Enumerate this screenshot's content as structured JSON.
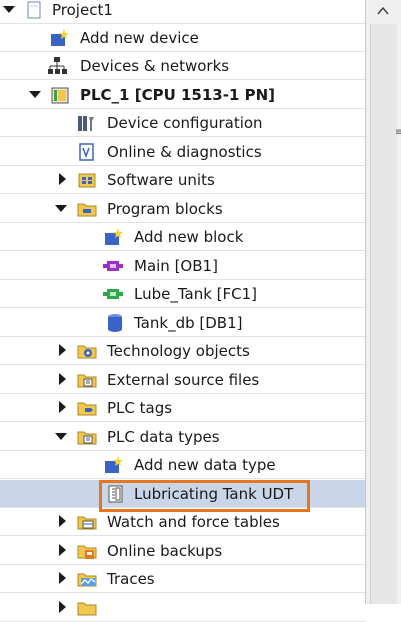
{
  "tree": {
    "items": [
      {
        "label": "Project1",
        "icon": "project-icon",
        "expander": "expanded"
      },
      {
        "label": "Add new device",
        "icon": "add-device-icon",
        "expander": "none"
      },
      {
        "label": "Devices & networks",
        "icon": "network-icon",
        "expander": "none"
      },
      {
        "label": "PLC_1 [CPU 1513-1 PN]",
        "icon": "plc-icon",
        "expander": "expanded",
        "bold": true
      },
      {
        "label": "Device configuration",
        "icon": "device-config-icon",
        "expander": "none"
      },
      {
        "label": "Online & diagnostics",
        "icon": "diagnostics-icon",
        "expander": "none"
      },
      {
        "label": "Software units",
        "icon": "software-units-icon",
        "expander": "collapsed"
      },
      {
        "label": "Program blocks",
        "icon": "folder-blocks-icon",
        "expander": "expanded"
      },
      {
        "label": "Add new block",
        "icon": "add-block-icon",
        "expander": "none"
      },
      {
        "label": "Main [OB1]",
        "icon": "ob-block-icon",
        "expander": "none"
      },
      {
        "label": "Lube_Tank [FC1]",
        "icon": "fc-block-icon",
        "expander": "none"
      },
      {
        "label": "Tank_db [DB1]",
        "icon": "db-block-icon",
        "expander": "none"
      },
      {
        "label": "Technology objects",
        "icon": "technology-folder-icon",
        "expander": "collapsed"
      },
      {
        "label": "External source files",
        "icon": "source-folder-icon",
        "expander": "collapsed"
      },
      {
        "label": "PLC tags",
        "icon": "tags-folder-icon",
        "expander": "collapsed"
      },
      {
        "label": "PLC data types",
        "icon": "datatypes-folder-icon",
        "expander": "expanded"
      },
      {
        "label": "Add new data type",
        "icon": "add-datatype-icon",
        "expander": "none"
      },
      {
        "label": "Lubricating Tank UDT",
        "icon": "udt-icon",
        "expander": "none",
        "selected": true
      },
      {
        "label": "Watch and force tables",
        "icon": "watch-folder-icon",
        "expander": "collapsed"
      },
      {
        "label": "Online backups",
        "icon": "backup-folder-icon",
        "expander": "collapsed"
      },
      {
        "label": "Traces",
        "icon": "traces-folder-icon",
        "expander": "collapsed"
      },
      {
        "label": "",
        "icon": "folder-icon",
        "expander": "collapsed"
      }
    ]
  },
  "colors": {
    "selection": "#c9d6ea",
    "highlight_border": "#e8761d",
    "folder_yellow": "#f3c74d",
    "block_purple": "#9a2fc9",
    "block_green": "#2ea84a",
    "db_blue": "#3a63c6"
  }
}
